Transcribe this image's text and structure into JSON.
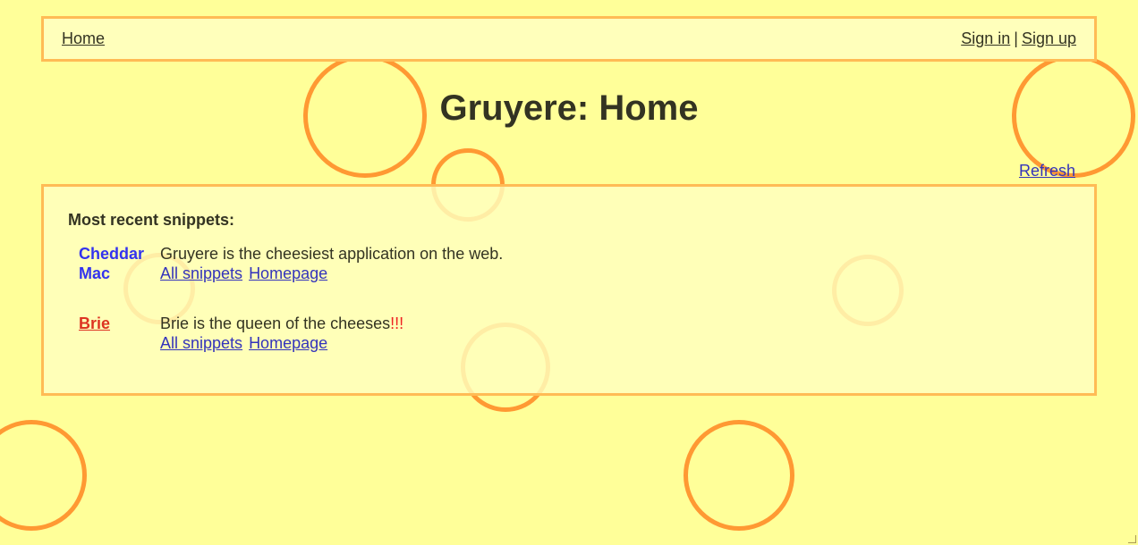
{
  "nav": {
    "home": "Home",
    "sign_in": "Sign in",
    "separator": "|",
    "sign_up": "Sign up"
  },
  "page_title": "Gruyere: Home",
  "refresh": "Refresh",
  "snippets": {
    "heading": "Most recent snippets:",
    "items": [
      {
        "author": "Cheddar Mac",
        "text": "Gruyere is the cheesiest application on the web.",
        "all_snippets": "All snippets",
        "homepage": "Homepage"
      },
      {
        "author": "Brie",
        "text": "Brie is the queen of the cheeses",
        "emphasis": "!!!",
        "all_snippets": "All snippets",
        "homepage": "Homepage"
      }
    ]
  },
  "colors": {
    "background": "#ffff99",
    "panel": "#ffffbb",
    "border": "#ffbb55",
    "hole": "#ff9933",
    "link": "#3333bb",
    "author_highlight": "#dd3322"
  }
}
